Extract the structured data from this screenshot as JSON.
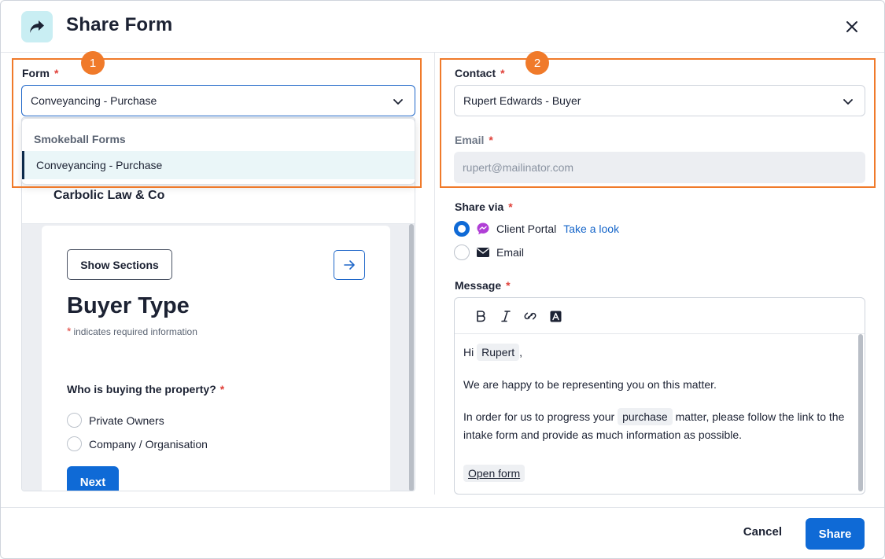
{
  "header": {
    "title": "Share Form",
    "icon": "share-arrow-icon",
    "close_icon": "close-icon"
  },
  "callouts": [
    "1",
    "2"
  ],
  "form_field": {
    "label": "Form",
    "required_mark": "*",
    "selected": "Conveyancing - Purchase",
    "dropdown": {
      "group": "Smokeball Forms",
      "items": [
        "Conveyancing - Purchase"
      ]
    }
  },
  "preview": {
    "firm_name": "Carbolic Law & Co",
    "show_sections": "Show Sections",
    "heading": "Buyer Type",
    "required_star": "*",
    "required_note": "indicates required information",
    "question": "Who is buying the property?",
    "question_star": "*",
    "options": [
      "Private Owners",
      "Company / Organisation"
    ],
    "next": "Next"
  },
  "contact_field": {
    "label": "Contact",
    "required_mark": "*",
    "selected": "Rupert Edwards - Buyer"
  },
  "email_field": {
    "label": "Email",
    "required_mark": "*",
    "value": "rupert@mailinator.com"
  },
  "share_via": {
    "label": "Share via",
    "required_mark": "*",
    "options": [
      {
        "label": "Client Portal",
        "selected": true,
        "icon": "chat-bubble-icon"
      },
      {
        "label": "Email",
        "selected": false,
        "icon": "envelope-icon"
      }
    ],
    "take_a_look": "Take a look"
  },
  "message": {
    "label": "Message",
    "required_mark": "*",
    "toolbar": [
      "bold-icon",
      "italic-icon",
      "link-icon",
      "text-color-icon"
    ],
    "greeting_prefix": "Hi",
    "contact_chip": "Rupert",
    "greeting_suffix": ",",
    "line1": "We are happy to be representing you on this matter.",
    "line2_prefix": "In order for us to progress your",
    "matter_chip": "purchase",
    "line2_suffix": "matter, please follow the link to the intake form and provide as much information as possible.",
    "open_form": "Open form"
  },
  "footer": {
    "cancel": "Cancel",
    "share": "Share"
  },
  "colors": {
    "accent": "#0f6ad6",
    "callout": "#f07a2a",
    "required": "#e0413a",
    "header_icon_bg": "#c9eef3",
    "portal_icon": "#b03fd6"
  }
}
